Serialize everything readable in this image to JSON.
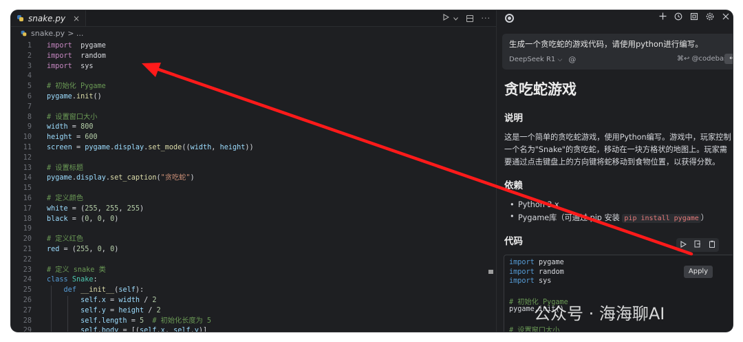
{
  "editor": {
    "tab_label": "snake.py",
    "tab_close": "×",
    "breadcrumb_file": "snake.py",
    "breadcrumb_rest": "> ...",
    "lines": [
      {
        "n": "1",
        "t": [
          [
            "kw",
            "import"
          ],
          [
            "",
            "  "
          ],
          [
            "",
            "pygame"
          ]
        ]
      },
      {
        "n": "2",
        "t": [
          [
            "kw",
            "import"
          ],
          [
            "",
            "  "
          ],
          [
            "",
            "random"
          ]
        ]
      },
      {
        "n": "3",
        "t": [
          [
            "kw",
            "import"
          ],
          [
            "",
            "  "
          ],
          [
            "",
            "sys"
          ]
        ]
      },
      {
        "n": "4",
        "t": []
      },
      {
        "n": "5",
        "t": [
          [
            "cm",
            "# 初始化 Pygame"
          ]
        ]
      },
      {
        "n": "6",
        "t": [
          [
            "id",
            "pygame"
          ],
          [
            "",
            "."
          ],
          [
            "fn",
            "init"
          ],
          [
            "",
            "()"
          ]
        ]
      },
      {
        "n": "7",
        "t": []
      },
      {
        "n": "8",
        "t": [
          [
            "cm",
            "# 设置窗口大小"
          ]
        ]
      },
      {
        "n": "9",
        "t": [
          [
            "id",
            "width"
          ],
          [
            "",
            " = "
          ],
          [
            "num",
            "800"
          ]
        ]
      },
      {
        "n": "10",
        "t": [
          [
            "id",
            "height"
          ],
          [
            "",
            " = "
          ],
          [
            "num",
            "600"
          ]
        ]
      },
      {
        "n": "11",
        "t": [
          [
            "id",
            "screen"
          ],
          [
            "",
            " = "
          ],
          [
            "id",
            "pygame"
          ],
          [
            "",
            "."
          ],
          [
            "id",
            "display"
          ],
          [
            "",
            "."
          ],
          [
            "fn",
            "set_mode"
          ],
          [
            "",
            "(("
          ],
          [
            "id",
            "width"
          ],
          [
            "",
            ", "
          ],
          [
            "id",
            "height"
          ],
          [
            "",
            "))"
          ]
        ]
      },
      {
        "n": "12",
        "t": []
      },
      {
        "n": "13",
        "t": [
          [
            "cm",
            "# 设置标题"
          ]
        ]
      },
      {
        "n": "14",
        "t": [
          [
            "id",
            "pygame"
          ],
          [
            "",
            "."
          ],
          [
            "id",
            "display"
          ],
          [
            "",
            "."
          ],
          [
            "fn",
            "set_caption"
          ],
          [
            "",
            "("
          ],
          [
            "str",
            "\"贪吃蛇\""
          ],
          [
            "",
            ")"
          ]
        ]
      },
      {
        "n": "15",
        "t": []
      },
      {
        "n": "16",
        "t": [
          [
            "cm",
            "# 定义颜色"
          ]
        ]
      },
      {
        "n": "17",
        "t": [
          [
            "id",
            "white"
          ],
          [
            "",
            " = ("
          ],
          [
            "num",
            "255"
          ],
          [
            "",
            ", "
          ],
          [
            "num",
            "255"
          ],
          [
            "",
            ", "
          ],
          [
            "num",
            "255"
          ],
          [
            "",
            ")"
          ]
        ]
      },
      {
        "n": "18",
        "t": [
          [
            "id",
            "black"
          ],
          [
            "",
            " = ("
          ],
          [
            "num",
            "0"
          ],
          [
            "",
            ", "
          ],
          [
            "num",
            "0"
          ],
          [
            "",
            ", "
          ],
          [
            "num",
            "0"
          ],
          [
            "",
            ")"
          ]
        ]
      },
      {
        "n": "19",
        "t": []
      },
      {
        "n": "20",
        "t": [
          [
            "cm",
            "# 定义红色"
          ]
        ]
      },
      {
        "n": "21",
        "t": [
          [
            "id",
            "red"
          ],
          [
            "",
            " = ("
          ],
          [
            "num",
            "255"
          ],
          [
            "",
            ", "
          ],
          [
            "num",
            "0"
          ],
          [
            "",
            ", "
          ],
          [
            "num",
            "0"
          ],
          [
            "",
            ")"
          ]
        ]
      },
      {
        "n": "22",
        "t": []
      },
      {
        "n": "23",
        "t": [
          [
            "cm",
            "# 定义 snake 类"
          ]
        ]
      },
      {
        "n": "24",
        "t": [
          [
            "kw2",
            "class"
          ],
          [
            "",
            " "
          ],
          [
            "cl",
            "Snake"
          ],
          [
            "",
            ":"
          ]
        ]
      },
      {
        "n": "25",
        "t": [
          [
            "",
            "    "
          ],
          [
            "kw2",
            "def"
          ],
          [
            "",
            " "
          ],
          [
            "fn",
            "__init__"
          ],
          [
            "",
            "("
          ],
          [
            "id",
            "self"
          ],
          [
            "",
            "):"
          ]
        ]
      },
      {
        "n": "26",
        "t": [
          [
            "",
            "        "
          ],
          [
            "id",
            "self"
          ],
          [
            "",
            "."
          ],
          [
            "id",
            "x"
          ],
          [
            "",
            " = "
          ],
          [
            "id",
            "width"
          ],
          [
            "",
            " / "
          ],
          [
            "num",
            "2"
          ]
        ]
      },
      {
        "n": "27",
        "t": [
          [
            "",
            "        "
          ],
          [
            "id",
            "self"
          ],
          [
            "",
            "."
          ],
          [
            "id",
            "y"
          ],
          [
            "",
            " = "
          ],
          [
            "id",
            "height"
          ],
          [
            "",
            " / "
          ],
          [
            "num",
            "2"
          ]
        ]
      },
      {
        "n": "28",
        "t": [
          [
            "",
            "        "
          ],
          [
            "id",
            "self"
          ],
          [
            "",
            "."
          ],
          [
            "id",
            "length"
          ],
          [
            "",
            " = "
          ],
          [
            "num",
            "5"
          ],
          [
            "",
            "  "
          ],
          [
            "cm",
            "# 初始化长度为 5"
          ]
        ]
      },
      {
        "n": "29",
        "t": [
          [
            "",
            "        "
          ],
          [
            "id",
            "self"
          ],
          [
            "",
            "."
          ],
          [
            "id",
            "body"
          ],
          [
            "",
            " = [("
          ],
          [
            "id",
            "self"
          ],
          [
            "",
            "."
          ],
          [
            "id",
            "x"
          ],
          [
            "",
            ", "
          ],
          [
            "id",
            "self"
          ],
          [
            "",
            "."
          ],
          [
            "id",
            "y"
          ],
          [
            "",
            ")]"
          ]
        ]
      }
    ]
  },
  "chat": {
    "prompt": "生成一个贪吃蛇的游戏代码，请使用python进行编写。",
    "model": "DeepSeek R1",
    "model_caret": "⌵",
    "at_symbol": "@",
    "codebase_hint": "⌘↩ @codebase",
    "send_symbol": "↩",
    "title": "贪吃蛇游戏",
    "section_intro": "说明",
    "intro_line1": "这是一个简单的贪吃蛇游戏，使用Python编写。游戏中，玩家控制",
    "intro_line2": "一个名为\"Snake\"的贪吃蛇，移动在一块方格状的地图上。玩家需",
    "intro_line3": "要通过点击键盘上的方向键将蛇移动到食物位置，以获得分数。",
    "section_deps": "依赖",
    "dep1": "Python 3.x",
    "dep2_prefix": "Pygame库（可通过 pip 安装 ",
    "dep2_code": "pip install pygame",
    "dep2_suffix": "）",
    "section_code": "代码",
    "code_lines": [
      [
        [
          "kw2",
          "import"
        ],
        [
          "",
          " pygame"
        ]
      ],
      [
        [
          "kw2",
          "import"
        ],
        [
          "",
          " random"
        ]
      ],
      [
        [
          "kw2",
          "import"
        ],
        [
          "",
          " sys"
        ]
      ],
      [],
      [
        [
          "cm",
          "# 初始化 Pygame"
        ]
      ],
      [
        [
          "",
          "pygame.init()"
        ]
      ],
      [],
      [
        [
          "cm",
          "# 设置窗口大小"
        ]
      ]
    ],
    "apply_tooltip": "Apply"
  },
  "watermark": "公众号 · 海海聊AI",
  "colors": {
    "arrow": "#ff1a1a"
  }
}
